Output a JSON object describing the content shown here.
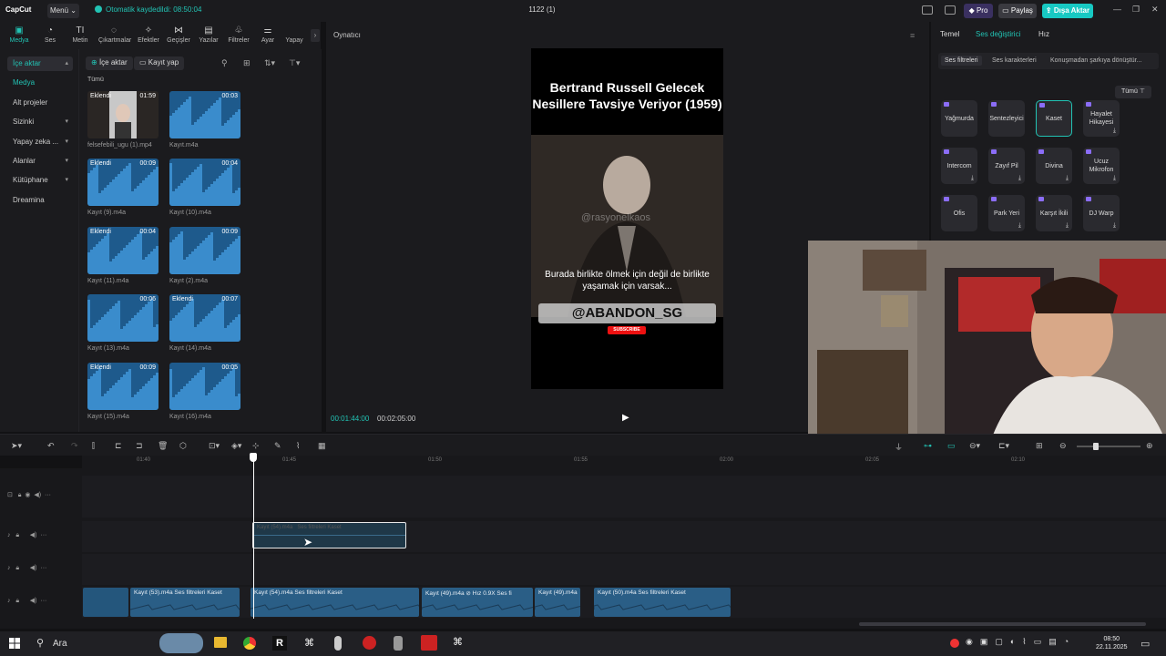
{
  "titlebar": {
    "logo": "CapCut",
    "menu": "Menü",
    "autosave": "Otomatik kaydedildi: 08:50:04",
    "project_title": "1122 (1)",
    "pro": "Pro",
    "share": "Paylaş",
    "export": "Dışa Aktar"
  },
  "tools": [
    {
      "label": "Medya",
      "icon": "media-icon"
    },
    {
      "label": "Ses",
      "icon": "audio-icon"
    },
    {
      "label": "Metin",
      "icon": "text-icon"
    },
    {
      "label": "Çıkartmalar",
      "icon": "sticker-icon"
    },
    {
      "label": "Efektler",
      "icon": "effects-icon"
    },
    {
      "label": "Geçişler",
      "icon": "transition-icon"
    },
    {
      "label": "Yazılar",
      "icon": "captions-icon"
    },
    {
      "label": "Filtreler",
      "icon": "filter-icon"
    },
    {
      "label": "Ayar",
      "icon": "adjust-icon"
    },
    {
      "label": "Yapay",
      "icon": "ai-icon"
    }
  ],
  "leftnav": {
    "import": "İçe aktar",
    "media": "Medya",
    "subprojects": "Alt projeler",
    "library_spaces": "Sizinki",
    "ai": "Yapay zeka ...",
    "spaces": "Alanlar",
    "library": "Kütüphane",
    "dreamina": "Dreamina"
  },
  "media": {
    "import_btn": "İçe aktar",
    "record_btn": "Kayıt yap",
    "all": "Tümü",
    "items": [
      {
        "name": "felsefebili_ugu (1).mp4",
        "duration": "01:59",
        "tag": "Eklendi",
        "kind": "video"
      },
      {
        "name": "Kayıt.m4a",
        "duration": "00:03",
        "tag": "",
        "kind": "audio"
      },
      {
        "name": "Kayıt (9).m4a",
        "duration": "00:09",
        "tag": "Eklendi",
        "kind": "audio"
      },
      {
        "name": "Kayıt (10).m4a",
        "duration": "00:04",
        "tag": "",
        "kind": "audio"
      },
      {
        "name": "Kayıt (11).m4a",
        "duration": "00:04",
        "tag": "Eklendi",
        "kind": "audio"
      },
      {
        "name": "Kayıt (2).m4a",
        "duration": "00:09",
        "tag": "",
        "kind": "audio"
      },
      {
        "name": "Kayıt (13).m4a",
        "duration": "00:06",
        "tag": "",
        "kind": "audio"
      },
      {
        "name": "Kayıt (14).m4a",
        "duration": "00:07",
        "tag": "Eklendi",
        "kind": "audio"
      },
      {
        "name": "Kayıt (15).m4a",
        "duration": "00:09",
        "tag": "Eklendi",
        "kind": "audio"
      },
      {
        "name": "Kayıt (16).m4a",
        "duration": "00:05",
        "tag": "",
        "kind": "audio"
      }
    ]
  },
  "player": {
    "title": "Oynatıcı",
    "video_title": "Bertrand Russell Gelecek Nesillere Tavsiye Veriyor (1959)",
    "watermark": "@rasyonelkaos",
    "subtitle": "Burada birlikte ölmek için değil de birlikte yaşamak için varsak...",
    "handle": "@ABANDON_SG",
    "subscribe": "SUBSCRIBE",
    "time_current": "00:01:44:00",
    "time_total": "00:02:05:00"
  },
  "rightpanel": {
    "tabs": [
      "Temel",
      "Ses değiştirici",
      "Hız"
    ],
    "subtabs": [
      "Ses filtreleri",
      "Ses karakterleri",
      "Konuşmadan şarkıya dönüştür..."
    ],
    "all": "Tümü",
    "effects": [
      {
        "label": "Yağmurda",
        "download": false,
        "selected": false
      },
      {
        "label": "Sentezleyici",
        "download": false,
        "selected": false
      },
      {
        "label": "Kaset",
        "download": false,
        "selected": true
      },
      {
        "label": "Hayalet Hikayesi",
        "download": true,
        "selected": false
      },
      {
        "label": "Intercom",
        "download": true,
        "selected": false
      },
      {
        "label": "Zayıf Pil",
        "download": true,
        "selected": false
      },
      {
        "label": "Divina",
        "download": true,
        "selected": false
      },
      {
        "label": "Ucuz Mikrofon",
        "download": true,
        "selected": false
      },
      {
        "label": "Ofis",
        "download": false,
        "selected": false
      },
      {
        "label": "Park Yeri",
        "download": true,
        "selected": false
      },
      {
        "label": "Karşıt İkili",
        "download": true,
        "selected": false
      },
      {
        "label": "DJ Warp",
        "download": true,
        "selected": false
      }
    ]
  },
  "timeline": {
    "ruler": [
      "01:40",
      "01:45",
      "01:50",
      "01:55",
      "02:00",
      "02:05",
      "02:10"
    ],
    "selected_clip": {
      "name": "Kayıt (54).m4a",
      "filter": "Ses filtreleri Kaset"
    },
    "audio_clips": [
      {
        "label": "Kayıt (53).m4a   Ses filtreleri Kaset"
      },
      {
        "label": "Kayıt (54).m4a   Ses filtreleri Kaset"
      },
      {
        "label": "Kayıt (49).m4a   ⊘ Hız 0.9X   Ses fi"
      },
      {
        "label": "Kayıt (49).m4a"
      },
      {
        "label": "Kayıt (50).m4a   Ses filtreleri Kaset"
      }
    ]
  },
  "taskbar": {
    "search": "Ara",
    "time": "08:50",
    "date": "22.11.2025"
  }
}
